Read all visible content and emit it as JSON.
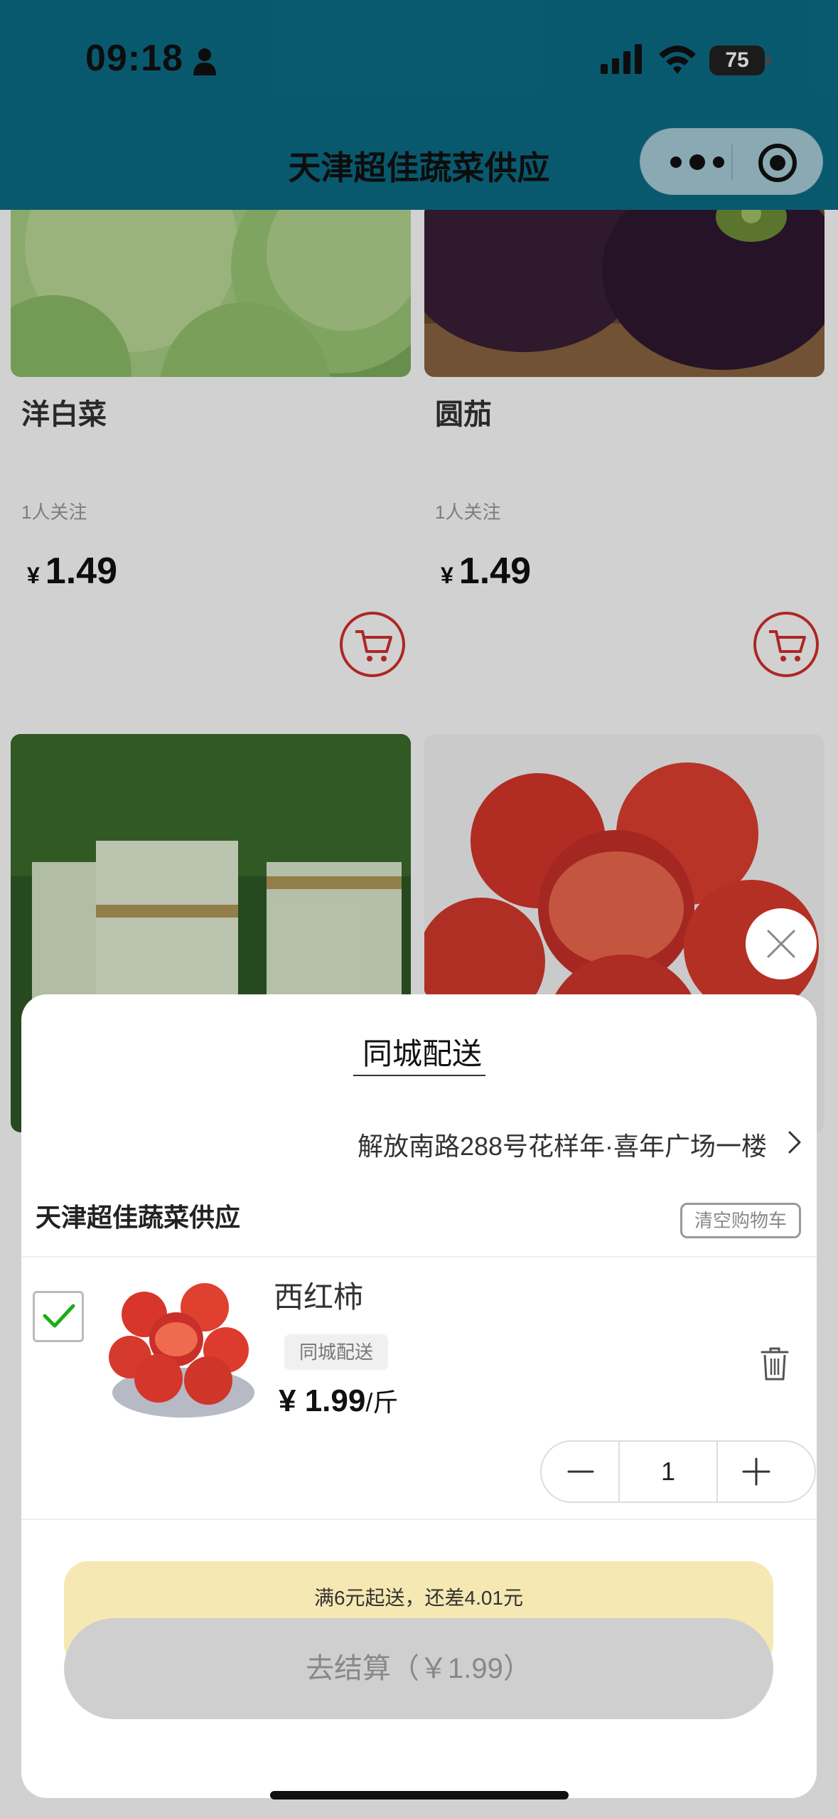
{
  "status_bar": {
    "time": "09:18",
    "battery": "75"
  },
  "nav": {
    "title": "天津超佳蔬菜供应",
    "icons": [
      "more-dots-icon",
      "target-icon"
    ]
  },
  "products": [
    {
      "name": "洋白菜",
      "followers": "1人关注",
      "currency": "¥",
      "price": "1.49",
      "image": "cabbage"
    },
    {
      "name": "圆茄",
      "followers": "1人关注",
      "currency": "¥",
      "price": "1.49",
      "image": "eggplant"
    },
    {
      "name": "",
      "image": "scallion"
    },
    {
      "name": "",
      "image": "tomato"
    }
  ],
  "cart_sheet": {
    "tab_label": "同城配送",
    "address": "解放南路288号花样年·喜年广场一楼",
    "shop_name": "天津超佳蔬菜供应",
    "clear_label": "清空购物车",
    "item": {
      "name": "西红柿",
      "tag": "同城配送",
      "price": "¥ 1.99",
      "unit": "/斤",
      "quantity": "1",
      "checked": true
    },
    "notice": "满6元起送，还差4.01元",
    "checkout_label": "去结算（￥1.99）"
  },
  "colors": {
    "header": "#0b6d87",
    "accent_red": "#d3302d",
    "check_green": "#1aad19",
    "notice_bg": "#f6e8b2"
  }
}
